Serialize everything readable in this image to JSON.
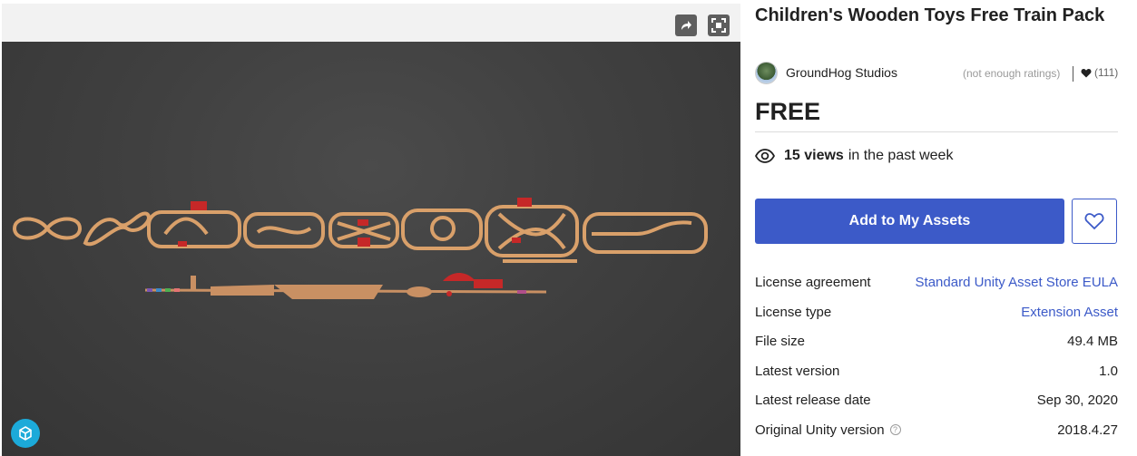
{
  "viewer": {
    "share_icon": "share-icon",
    "fullscreen_icon": "fullscreen-icon",
    "sketchfab_icon": "sketchfab-logo"
  },
  "product": {
    "title": "Children's Wooden Toys Free Train Pack",
    "publisher": "GroundHog Studios",
    "ratings_text": "(not enough ratings)",
    "favorites_count": "(111)",
    "price": "FREE",
    "views_count": "15 views",
    "views_suffix": "in the past week"
  },
  "actions": {
    "add_label": "Add to My Assets",
    "wishlist_icon": "heart-outline-icon"
  },
  "details": [
    {
      "label": "License agreement",
      "value": "Standard Unity Asset Store EULA",
      "link": true
    },
    {
      "label": "License type",
      "value": "Extension Asset",
      "link": true
    },
    {
      "label": "File size",
      "value": "49.4 MB",
      "link": false
    },
    {
      "label": "Latest version",
      "value": "1.0",
      "link": false
    },
    {
      "label": "Latest release date",
      "value": "Sep 30, 2020",
      "link": false
    },
    {
      "label": "Original Unity version",
      "value": "2018.4.27",
      "link": false,
      "help": true
    }
  ],
  "colors": {
    "accent": "#3c5ac8",
    "viewer_bg": "#404040",
    "track": "#d9a06a",
    "station_roof": "#c62828"
  }
}
